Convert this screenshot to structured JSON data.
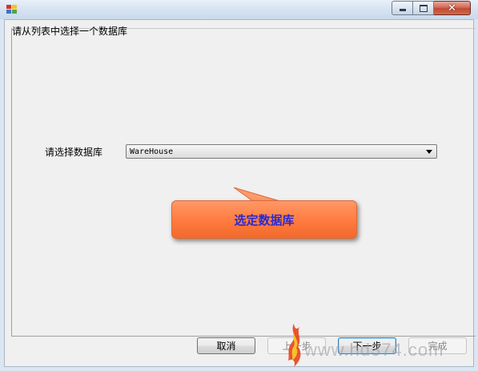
{
  "window": {
    "title": "",
    "controls": [
      "minimize-icon",
      "maximize-icon",
      "close-icon"
    ],
    "close_glyph": "✕"
  },
  "wizard": {
    "instruction": "请从列表中选择一个数据库",
    "database_label": "请选择数据库",
    "database_value": "WareHouse"
  },
  "callout": {
    "text": "选定数据库"
  },
  "buttons": {
    "cancel": "取消",
    "previous": "上一步",
    "next": "下一步",
    "finish": "完成"
  },
  "watermark": {
    "text": "www.hd374.com"
  },
  "colors": {
    "callout_fill": "#ff7a3e",
    "callout_text": "#2a2ad0",
    "close_button": "#c14a31"
  }
}
